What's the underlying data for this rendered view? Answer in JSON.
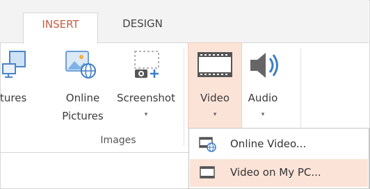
{
  "tabs": [
    {
      "label": "INSERT",
      "active": true
    },
    {
      "label": "DESIGN",
      "active": false
    }
  ],
  "ribbon": {
    "buttons": {
      "pictures": {
        "label": "tures"
      },
      "online_pictures": {
        "line1": "Online",
        "line2": "Pictures"
      },
      "screenshot": {
        "label": "Screenshot",
        "caret": "▾"
      },
      "video": {
        "label": "Video",
        "caret": "▾"
      },
      "audio": {
        "label": "Audio",
        "caret": "▾"
      }
    },
    "groups": {
      "images": "Images"
    }
  },
  "video_menu": {
    "items": [
      {
        "label": "Online Video...",
        "icon": "online-video-icon"
      },
      {
        "label": "Video on My PC...",
        "icon": "video-on-pc-icon",
        "highlighted": true
      }
    ]
  },
  "colors": {
    "accent": "#c75b3e",
    "highlight": "#fbe3d8",
    "icon_blue": "#3e7cc7"
  }
}
